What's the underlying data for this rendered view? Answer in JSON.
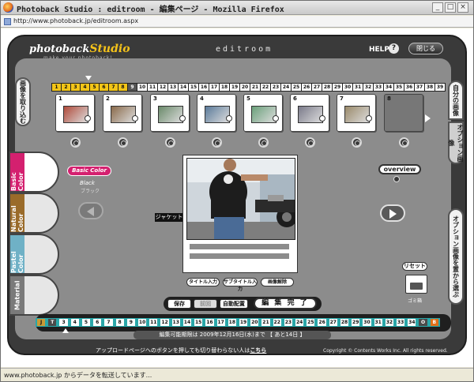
{
  "browser": {
    "title": "Photoback Studio : editroom - 編集ページ - Mozilla Firefox",
    "url": "http://www.photoback.jp/editroom.aspx",
    "status": "www.photoback.jp からデータを転送しています..."
  },
  "app": {
    "logo": "photoback",
    "logo_studio": "Studio",
    "tagline": "make your photoback!",
    "mode_title": "editroom",
    "help_label": "HELP",
    "help_icon_text": "?",
    "close_label": "閉じる",
    "import_label": "画像を取り込む",
    "my_images_label": "自分の画像",
    "option_images_label": "オプション画像",
    "option_select_label": "オプション画像を置から選ぶ"
  },
  "pages_top": [
    "1",
    "2",
    "3",
    "4",
    "5",
    "6",
    "7",
    "8",
    "9",
    "10",
    "11",
    "12",
    "13",
    "14",
    "15",
    "16",
    "17",
    "18",
    "19",
    "20",
    "21",
    "22",
    "23",
    "24",
    "25",
    "26",
    "27",
    "28",
    "29",
    "30",
    "31",
    "32",
    "33",
    "34",
    "35",
    "36",
    "37",
    "38",
    "39"
  ],
  "thumbnails": [
    "1",
    "2",
    "3",
    "4",
    "5",
    "6",
    "7",
    "8"
  ],
  "color_tabs": [
    "Basic Color",
    "Natural Color",
    "Pastel Color",
    "Material"
  ],
  "color_tab_colors": [
    "#d4206f",
    "#9a6b2a",
    "#6fb1c6",
    "#7a7a7a"
  ],
  "basic_color_btn": "Basic Color",
  "color_name": "Black",
  "color_kana": "ブラック",
  "jacket_label": "ジャケット",
  "overview_label": "overview",
  "buttons": {
    "title_input": "タイトル入力",
    "subtitle_input": "サブタイトル入力",
    "image_release": "画像解除",
    "save": "保存",
    "restore": "前回",
    "auto_layout": "自動配置",
    "finish": "編 集 完 了",
    "reset": "リセット",
    "trash": "ゴミ箱"
  },
  "pages_bottom": [
    "J",
    "T",
    "3",
    "4",
    "5",
    "6",
    "7",
    "8",
    "9",
    "10",
    "11",
    "12",
    "13",
    "14",
    "15",
    "16",
    "17",
    "18",
    "19",
    "20",
    "21",
    "22",
    "23",
    "24",
    "25",
    "26",
    "27",
    "28",
    "29",
    "30",
    "31",
    "32",
    "33",
    "34",
    "O",
    "B"
  ],
  "deadline_text": "編集可能期限は 2009年12月16日(水)まで 【 あと14日 】",
  "footer_left_text": "アップロードページへのボタンを押しても切り替わらない人は",
  "footer_left_link": "こちら",
  "footer_right_text": "Copyright © Contents Works Inc.  All rights reserved."
}
